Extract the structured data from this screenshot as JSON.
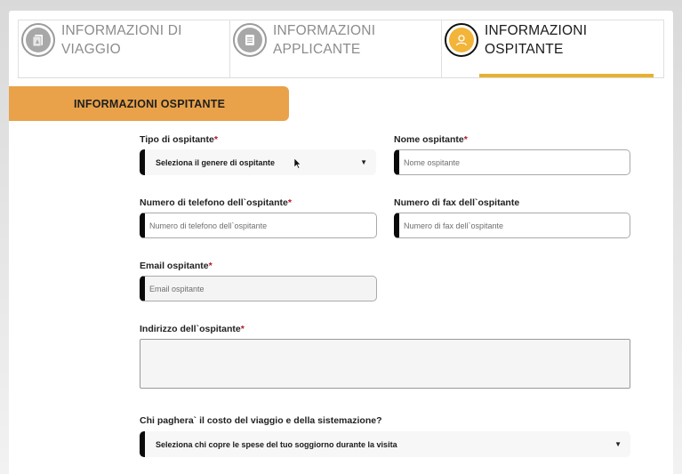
{
  "steps": [
    {
      "label": "INFORMAZIONI DI VIAGGIO",
      "icon": "travel-document-icon",
      "active": false
    },
    {
      "label": "INFORMAZIONI APPLICANTE",
      "icon": "list-icon",
      "active": false
    },
    {
      "label": "INFORMAZIONI OSPITANTE",
      "icon": "user-icon",
      "active": true
    }
  ],
  "section_title": "INFORMAZIONI OSPITANTE",
  "form": {
    "host_type": {
      "label": "Tipo di ospitante",
      "required": "*",
      "value": "Seleziona il genere di ospitante"
    },
    "host_name": {
      "label": "Nome ospitante",
      "required": "*",
      "placeholder": "Nome ospitante"
    },
    "host_phone": {
      "label": "Numero di telefono dell`ospitante",
      "required": "*",
      "placeholder": "Numero di telefono dell`ospitante"
    },
    "host_fax": {
      "label": "Numero di fax dell`ospitante",
      "placeholder": "Numero di fax dell`ospitante"
    },
    "host_email": {
      "label": "Email ospitante",
      "required": "*",
      "placeholder": "Email ospitante"
    },
    "host_address": {
      "label": "Indirizzo dell`ospitante",
      "required": "*"
    },
    "payer": {
      "label": "Chi paghera` il costo del viaggio e della sistemazione?",
      "value": "Seleziona chi copre le spese del tuo soggiorno durante la visita"
    }
  },
  "colors": {
    "accent": "#e9a24a",
    "active_underline": "#e7b12f",
    "required": "#b0182a"
  }
}
